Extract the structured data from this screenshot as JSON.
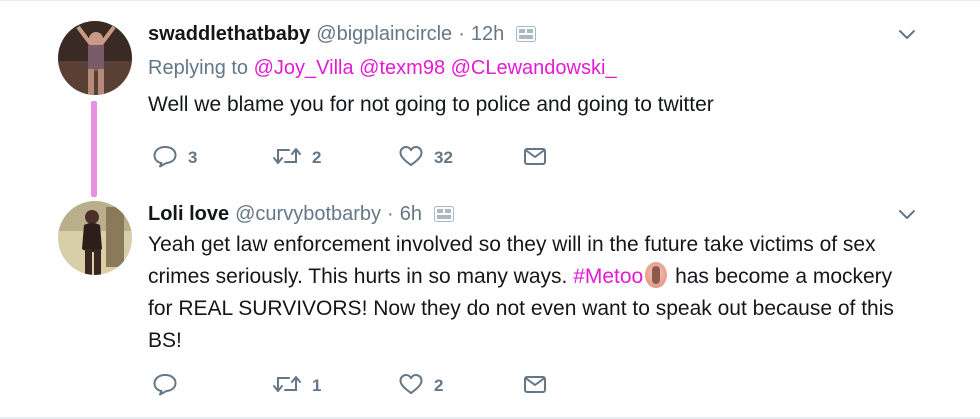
{
  "tweets": [
    {
      "fullname": "swaddlethatbaby",
      "username": "@bigplaincircle",
      "dot": "·",
      "time": "12h",
      "replying_prefix": "Replying to",
      "mentions": [
        "@Joy_Villa",
        "@texm98",
        "@CLewandowski_"
      ],
      "text": "Well we blame you for not going to police and going to twitter",
      "reply_count": "3",
      "retweet_count": "2",
      "like_count": "32"
    },
    {
      "fullname": "Loli love",
      "username": "@curvybotbarby",
      "dot": "·",
      "time": "6h",
      "text_before": "Yeah get law enforcement involved so they will in the future take victims of sex crimes seriously. This hurts in so many ways.",
      "hashtag": "#Metoo",
      "text_after": "has become a mockery for REAL SURVIVORS! Now they do not even want to speak out because of this BS!",
      "reply_count": "",
      "retweet_count": "1",
      "like_count": "2"
    }
  ],
  "icons": {
    "reply": "reply-icon",
    "retweet": "retweet-icon",
    "like": "heart-icon",
    "dm": "envelope-icon",
    "caret": "chevron-down-icon",
    "translate": "translate-icon",
    "emoji": "woman-emoji"
  },
  "colors": {
    "link": "#e41bd4",
    "secondary_text": "#657786",
    "primary_text": "#14171a",
    "thread_line": "#e88fe0"
  }
}
